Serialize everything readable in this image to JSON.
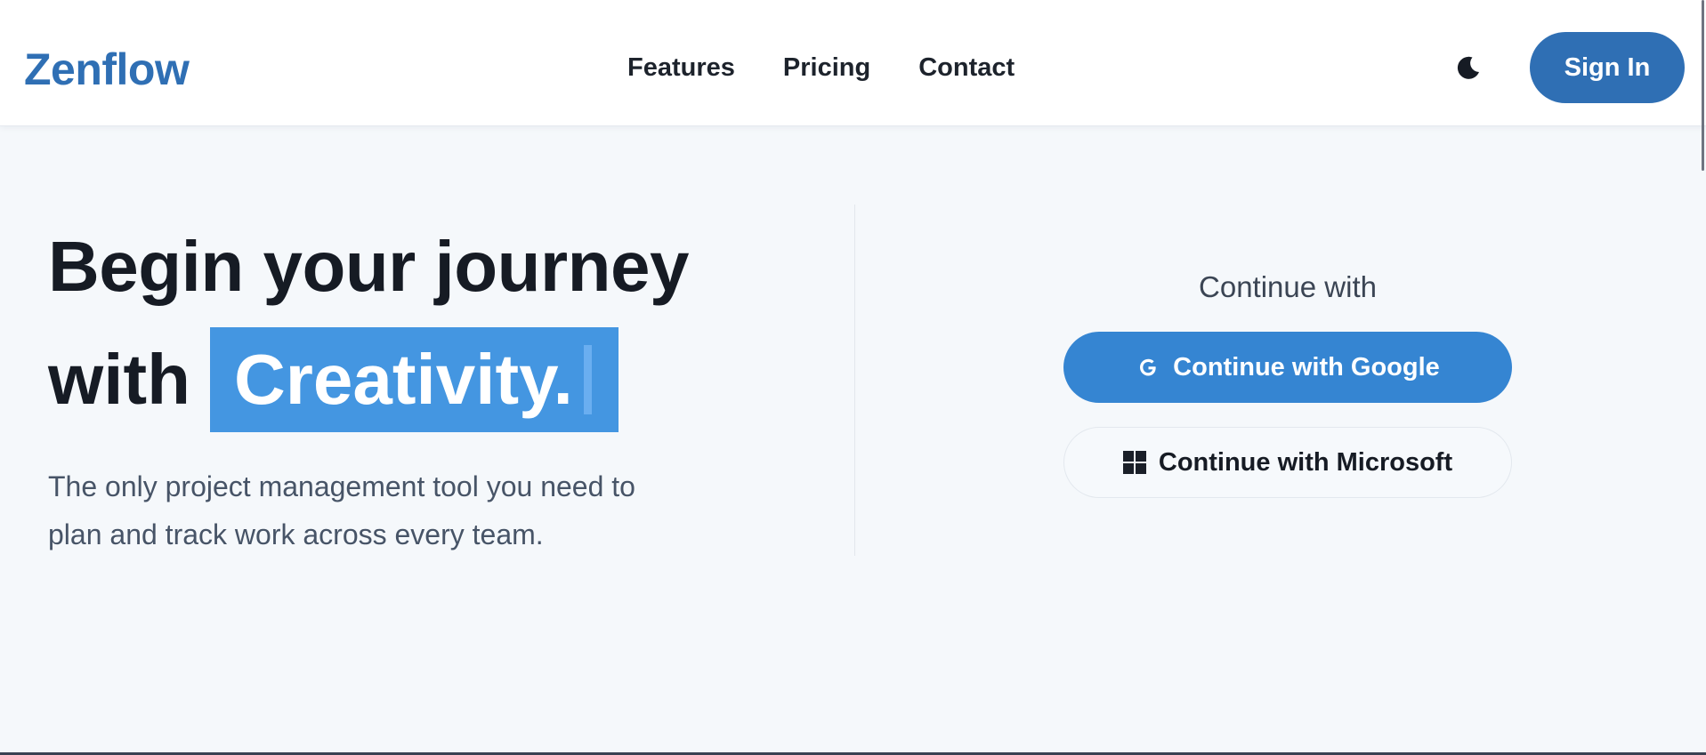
{
  "brand": {
    "name": "Zenflow",
    "color": "#2f6fb4"
  },
  "nav": {
    "links": [
      "Features",
      "Pricing",
      "Contact"
    ]
  },
  "header": {
    "theme_toggle_icon": "moon-icon",
    "signin_label": "Sign In"
  },
  "hero": {
    "title_line1": "Begin your journey",
    "title_with": "with",
    "highlight_word": "Creativity.",
    "highlight_color": "#4496e1",
    "subtitle": "The only project management tool you need to plan and track work across every team."
  },
  "auth": {
    "label": "Continue with",
    "google": {
      "label": "Continue with Google",
      "icon": "google-icon",
      "color": "#3585d2"
    },
    "microsoft": {
      "label": "Continue with Microsoft",
      "icon": "microsoft-icon"
    }
  }
}
